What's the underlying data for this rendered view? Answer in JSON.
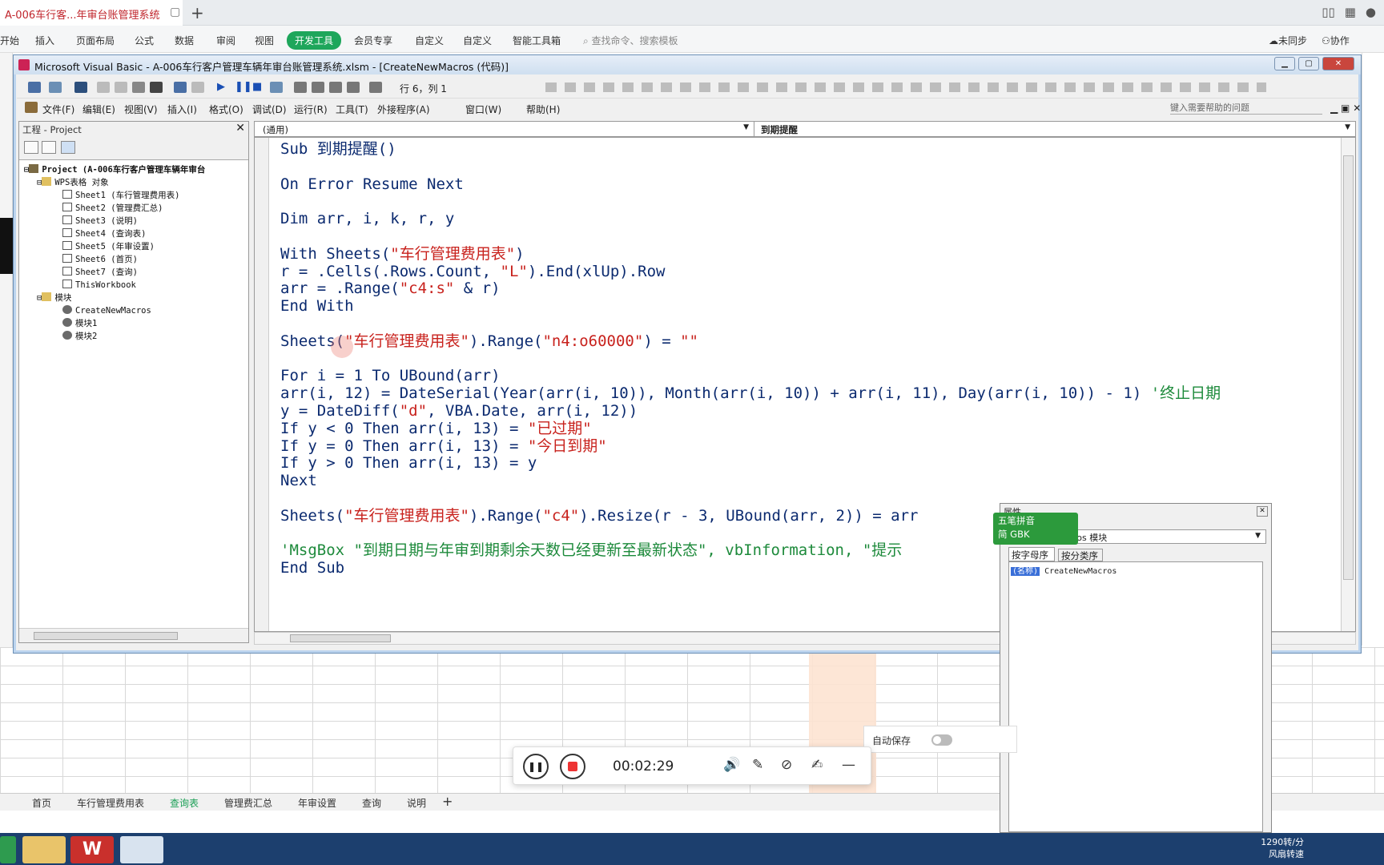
{
  "wps": {
    "tab_title": "A-006车行客...年审台账管理系统",
    "ribbon": [
      "开始",
      "插入",
      "页面布局",
      "公式",
      "数据",
      "审阅",
      "视图",
      "开发工具",
      "会员专享",
      "自定义",
      "自定义",
      "智能工具箱"
    ],
    "search_placeholder": "查找命令、搜索模板",
    "sync": "未同步",
    "collab": "协作"
  },
  "vba": {
    "title": "Microsoft Visual Basic - A-006车行客户管理车辆年审台账管理系统.xlsm - [CreateNewMacros (代码)]",
    "position": "行 6，列 1",
    "menu": [
      "文件(F)",
      "编辑(E)",
      "视图(V)",
      "插入(I)",
      "格式(O)",
      "调试(D)",
      "运行(R)",
      "工具(T)",
      "外接程序(A)",
      "窗口(W)",
      "帮助(H)"
    ],
    "help_placeholder": "键入需要帮助的问题",
    "project_title": "工程 - Project",
    "combo_left": "(通用)",
    "combo_right": "到期提醒"
  },
  "tree": [
    "Project (A-006车行客户管理车辆年审台",
    "WPS表格 对象",
    "Sheet1 (车行管理费用表)",
    "Sheet2 (管理费汇总)",
    "Sheet3 (说明)",
    "Sheet4 (查询表)",
    "Sheet5 (年审设置)",
    "Sheet6 (首页)",
    "Sheet7 (查询)",
    "ThisWorkbook",
    "模块",
    "CreateNewMacros",
    "模块1",
    "模块2"
  ],
  "code": [
    "Sub 到期提醒()",
    "",
    "On Error Resume Next",
    "",
    "Dim arr, i, k, r, y",
    "",
    "With Sheets(\"车行管理费用表\")",
    "r = .Cells(.Rows.Count, \"L\").End(xlUp).Row",
    "arr = .Range(\"c4:s\" & r)",
    "End With",
    "",
    "Sheets(\"车行管理费用表\").Range(\"n4:o60000\") = \"\"",
    "",
    "For i = 1 To UBound(arr)",
    "arr(i, 12) = DateSerial(Year(arr(i, 10)), Month(arr(i, 10)) + arr(i, 11), Day(arr(i, 10)) - 1) '终止日期",
    "y = DateDiff(\"d\", VBA.Date, arr(i, 12))",
    "If y < 0 Then arr(i, 13) = \"已过期\"",
    "If y = 0 Then arr(i, 13) = \"今日到期\"",
    "If y > 0 Then arr(i, 13) = y",
    "Next",
    "",
    "Sheets(\"车行管理费用表\").Range(\"c4\").Resize(r - 3, UBound(arr, 2)) = arr",
    "",
    "'MsgBox \"到期日期与年审到期剩余天数已经更新至最新状态\", vbInformation, \"提示",
    "End Sub"
  ],
  "props": {
    "title": "属性",
    "combo": "ros 模块",
    "tab_alpha": "按字母序",
    "tab_cat": "按分类序",
    "name_label": "(名称)",
    "name_value": "CreateNewMacros"
  },
  "ime": {
    "line1": "五笔拼音",
    "line2": "简 GBK"
  },
  "sheets": [
    "首页",
    "车行管理费用表",
    "查询表",
    "管理费汇总",
    "年审设置",
    "查询",
    "说明"
  ],
  "active_sheet": "查询表",
  "recorder": {
    "time": "00:02:29"
  },
  "autosave": "自动保存",
  "tray": {
    "speed": "1290转/分",
    "label": "风扇转速"
  }
}
